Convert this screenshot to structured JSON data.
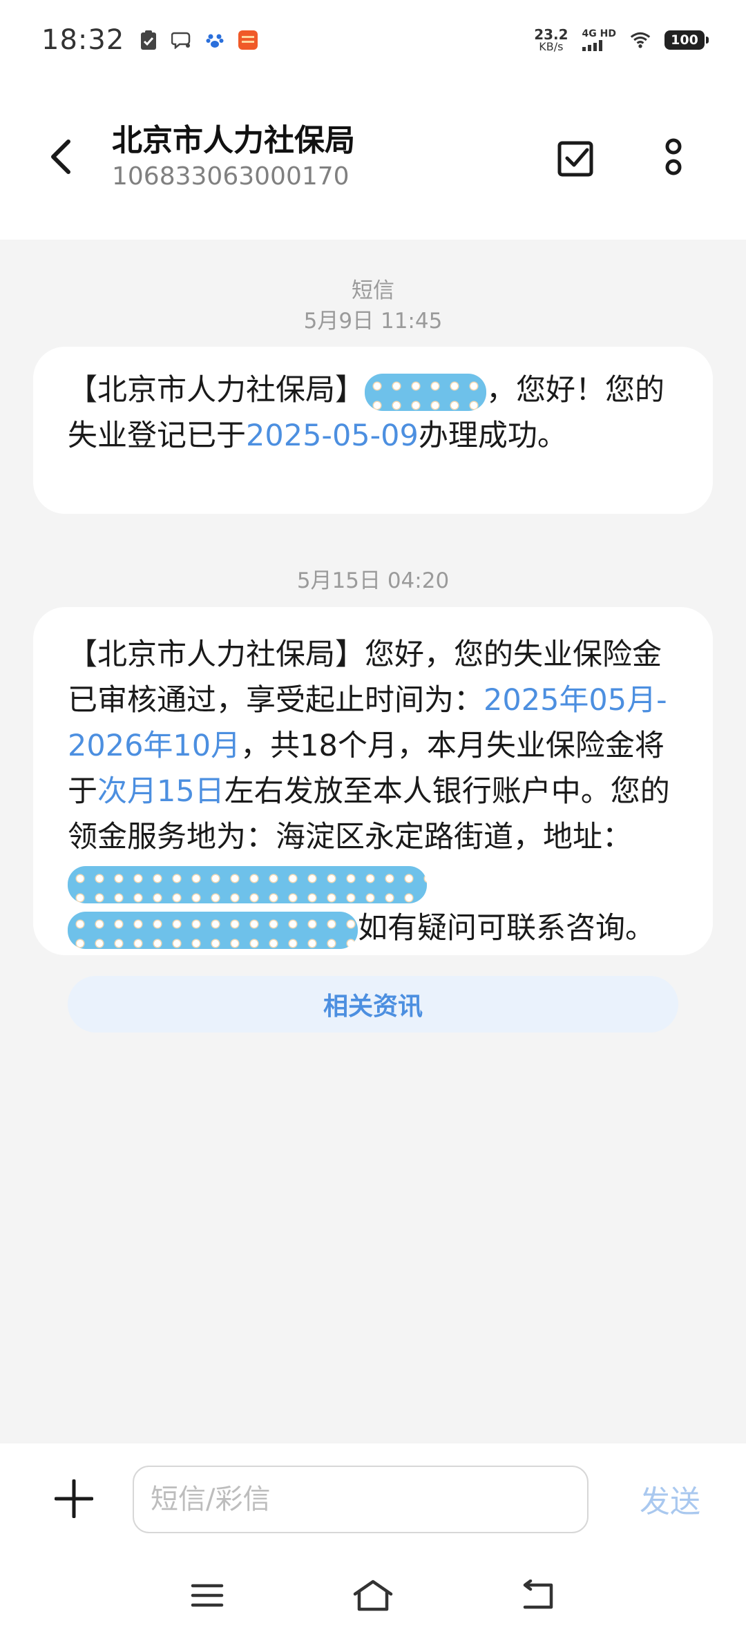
{
  "status_bar": {
    "time": "18:32",
    "net_speed_value": "23.2",
    "net_speed_unit": "KB/s",
    "network_label": "4G HD",
    "battery": "100"
  },
  "header": {
    "contact_name": "北京市人力社保局",
    "contact_number": "106833063000170"
  },
  "conversation": {
    "channel_label": "短信",
    "messages": [
      {
        "timestamp": "5月9日 11:45",
        "prefix": "【北京市人力社保局】",
        "after_redaction": "，您好！您的失业登记已于",
        "date_link": "2025-05-09",
        "suffix": "办理成功。"
      },
      {
        "timestamp": "5月15日 04:20",
        "part1": "【北京市人力社保局】您好，您的失业保险金已审核通过，享受起止时间为：",
        "period_link": "2025年05月-2026年10月",
        "part2": "，共18个月，本月失业保险金将于",
        "payday_link": "次月15日",
        "part3": "左右发放至本人银行账户中。您的领金服务地为：海淀区永定路街道，地址：",
        "part4": "如有疑问可联系咨询。",
        "related_button": "相关资讯"
      }
    ]
  },
  "input_bar": {
    "placeholder": "短信/彩信",
    "value": "",
    "send_label": "发送"
  },
  "icons": {
    "back": "chevron-left-icon",
    "select": "checkbox-icon",
    "more": "more-vertical-icon",
    "add": "plus-icon",
    "nav_menu": "menu-icon",
    "nav_home": "home-icon",
    "nav_back": "return-icon"
  },
  "colors": {
    "link": "#4c8fe0",
    "redaction": "#6ec1ea",
    "send_disabled": "#a9c8ef",
    "background": "#f4f4f4"
  }
}
